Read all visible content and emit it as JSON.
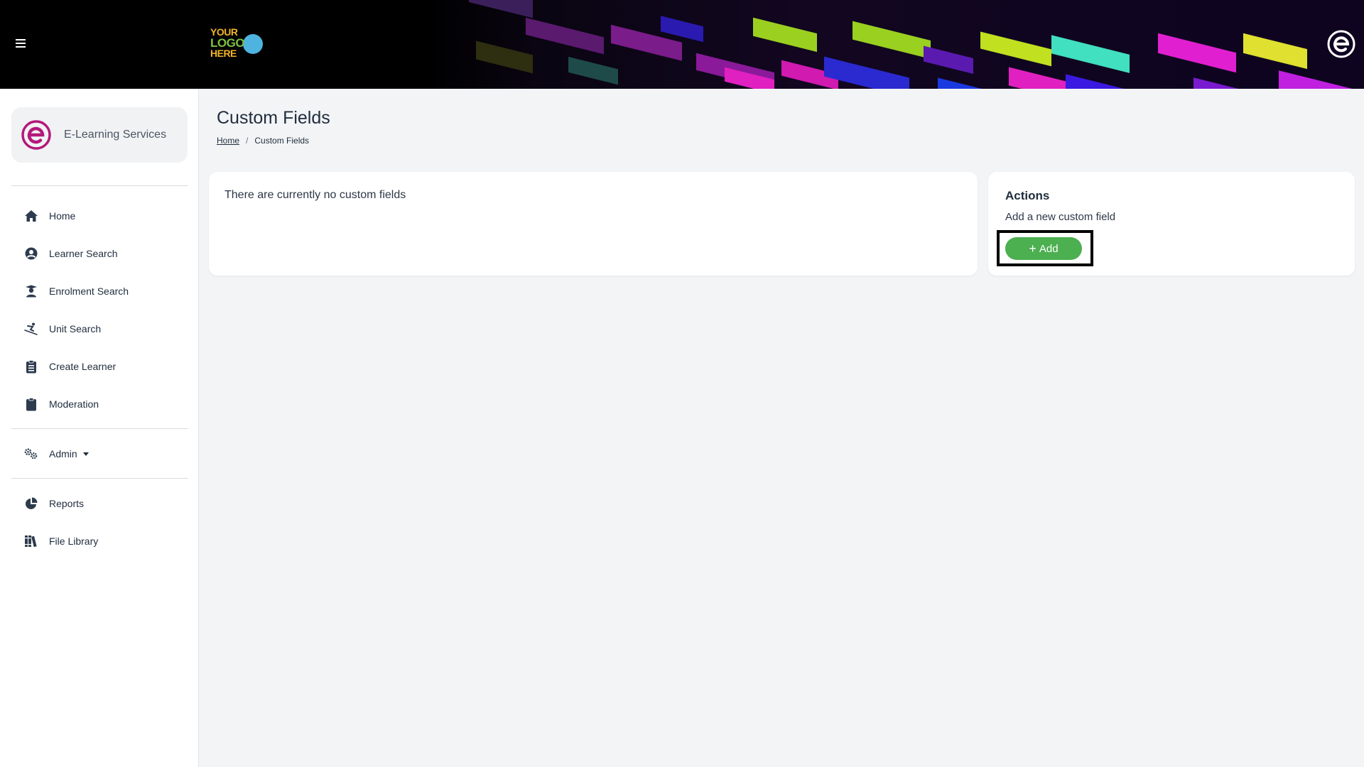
{
  "header": {
    "logo": {
      "line1": "YOUR",
      "line2": "LOGO",
      "line3": "HERE"
    }
  },
  "sidebar": {
    "org_name": "E-Learning Services",
    "items": [
      {
        "label": "Home",
        "icon": "home-icon"
      },
      {
        "label": "Learner Search",
        "icon": "user-circle-icon"
      },
      {
        "label": "Enrolment Search",
        "icon": "graduate-icon"
      },
      {
        "label": "Unit Search",
        "icon": "skier-icon"
      },
      {
        "label": "Create Learner",
        "icon": "clipboard-list-icon"
      },
      {
        "label": "Moderation",
        "icon": "clipboard-icon"
      },
      {
        "label": "Admin",
        "icon": "cogs-icon"
      },
      {
        "label": "Reports",
        "icon": "pie-chart-icon"
      },
      {
        "label": "File Library",
        "icon": "books-icon"
      }
    ]
  },
  "main": {
    "title": "Custom Fields",
    "breadcrumb": {
      "home": "Home",
      "separator": "/",
      "current": "Custom Fields"
    },
    "empty_message": "There are currently no custom fields",
    "actions": {
      "title": "Actions",
      "description": "Add a new custom field",
      "add_label": "Add"
    }
  },
  "colors": {
    "accent_green": "#4caf50",
    "brand_magenta": "#b4187a",
    "text_dark": "#1f2d3d",
    "page_bg": "#f3f4f6"
  }
}
